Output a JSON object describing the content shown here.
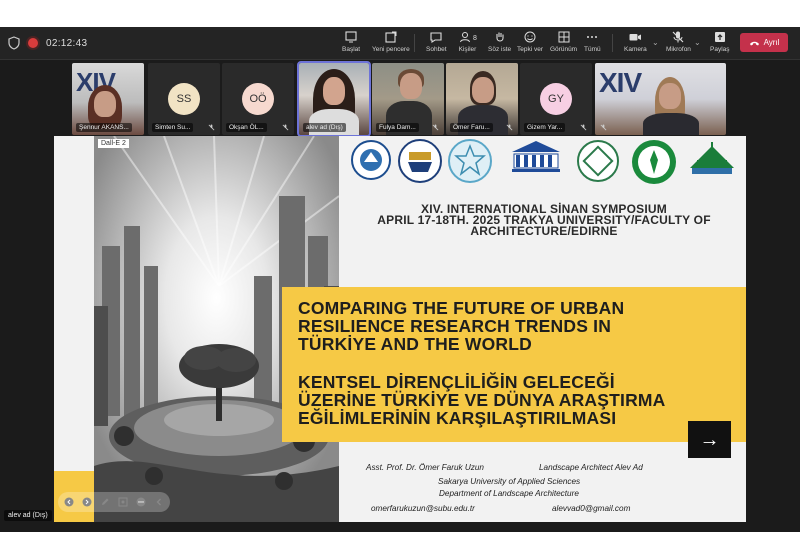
{
  "colors": {
    "toolbar_bg": "#242424",
    "leave_red": "#c4314b",
    "active_outline": "#6d73d8",
    "slide_yellow": "#f6c945",
    "rec_red": "#d93c3c"
  },
  "meeting": {
    "timer": "02:12:43"
  },
  "toolbar": {
    "buttons": [
      {
        "label": "Başlat",
        "icon": "share-window-icon"
      },
      {
        "label": "Yeni pencere",
        "icon": "new-window-icon"
      },
      {
        "label": "Sohbet",
        "icon": "chat-icon"
      },
      {
        "label": "Kişiler",
        "icon": "people-icon",
        "count": "8"
      },
      {
        "label": "Söz iste",
        "icon": "raise-hand-icon"
      },
      {
        "label": "Tepki ver",
        "icon": "reaction-icon"
      },
      {
        "label": "Görünüm",
        "icon": "view-grid-icon"
      },
      {
        "label": "Tümü",
        "icon": "more-icon"
      },
      {
        "label": "Kamera",
        "icon": "camera-icon"
      },
      {
        "label": "Mikrofon",
        "icon": "microphone-off-icon"
      },
      {
        "label": "Paylaş",
        "icon": "share-icon"
      }
    ],
    "leave_label": "Ayrıl"
  },
  "participants": [
    {
      "name": "Şennur AKANS...",
      "initials": "",
      "type": "video"
    },
    {
      "name": "Simten Su...",
      "initials": "SS",
      "type": "avatar",
      "color": "#f1e3c4"
    },
    {
      "name": "Okşan ÖL...",
      "initials": "OÖ",
      "type": "avatar",
      "color": "#f6d9cf"
    },
    {
      "name": "alev ad (Dış)",
      "initials": "",
      "type": "video",
      "active": true
    },
    {
      "name": "Fulya Dam...",
      "initials": "",
      "type": "video"
    },
    {
      "name": "Ömer Faru...",
      "initials": "",
      "type": "video"
    },
    {
      "name": "Gizem Yar...",
      "initials": "GY",
      "type": "avatar",
      "color": "#f7cfe3"
    },
    {
      "name": "",
      "initials": "",
      "type": "video"
    }
  ],
  "slide": {
    "tag": "Dall-E 2",
    "logo_xiv": "XIV",
    "symposium": {
      "line1": "XIV. INTERNATIONAL SİNAN SYMPOSIUM",
      "line2": "APRIL 17-18TH. 2025 TRAKYA UNIVERSITY/FACULTY OF",
      "line3": "ARCHITECTURE/EDIRNE"
    },
    "title_en": [
      "COMPARING THE FUTURE OF URBAN",
      "RESILIENCE RESEARCH TRENDS IN",
      "TÜRKİYE AND THE WORLD"
    ],
    "title_tr": [
      "KENTSEL DİRENÇLİLİĞİN GELECEĞİ",
      "ÜZERİNE TÜRKİYE VE DÜNYA ARAŞTIRMA",
      "EĞİLİMLERİNİN KARŞILAŞTIRILMASI"
    ],
    "next_arrow": "→",
    "authors": {
      "author1": "Asst. Prof. Dr. Ömer Faruk Uzun",
      "author2": "Landscape Architect Alev Ad",
      "affiliation1": "Sakarya University of Applied Sciences",
      "affiliation2": "Department of Landscape Architecture",
      "email1": "omerfarukuzun@subu.edu.tr",
      "email2": "alevvad0@gmail.com"
    }
  },
  "self_view": {
    "label": "alev ad (Dış)"
  }
}
